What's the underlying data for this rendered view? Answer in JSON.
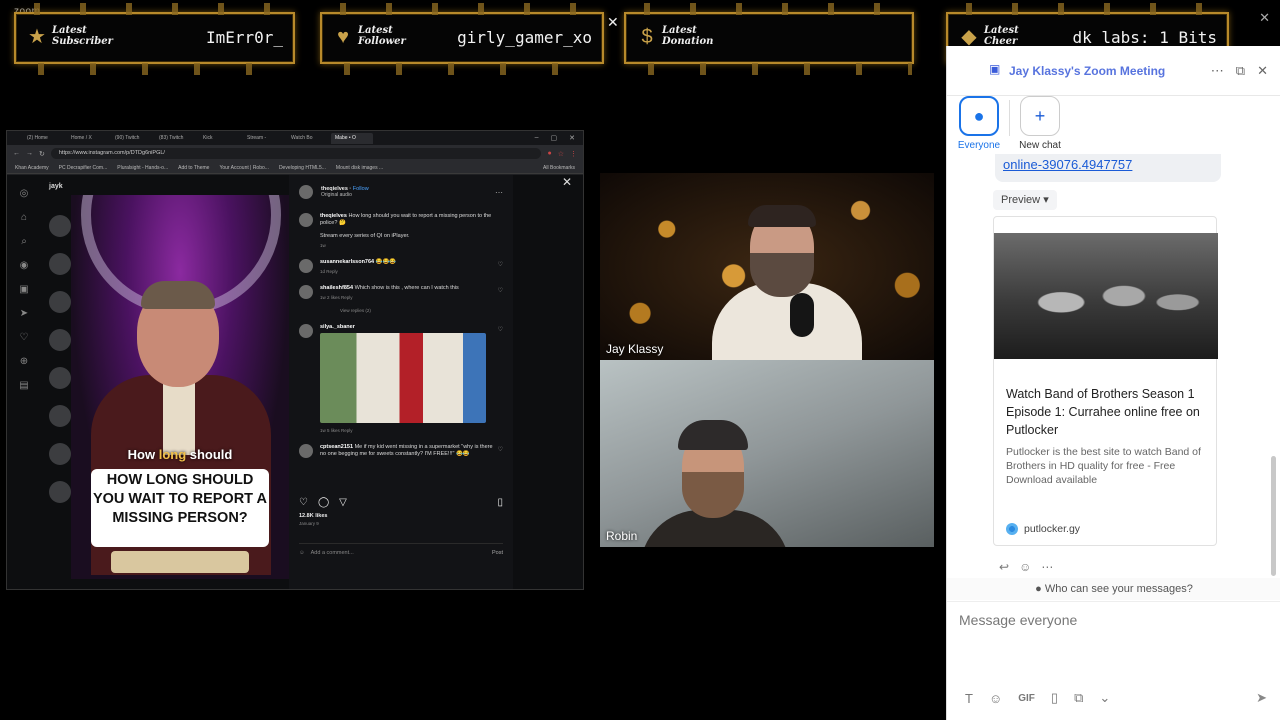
{
  "app": {
    "name": "zoom"
  },
  "alerts": [
    {
      "title": "Latest\nSubscriber",
      "value": "ImErr0r_"
    },
    {
      "title": "Latest\nFollower",
      "value": "girly_gamer_xo"
    },
    {
      "title": "Latest\nDonation",
      "value": ""
    },
    {
      "title": "Latest\nCheer",
      "value": "dk_labs: 1 Bits"
    }
  ],
  "browser": {
    "tabs": [
      "(2) Home",
      "Home / X",
      "(90) Twitch",
      "(83) Twitch",
      "Kick",
      "Stream - ",
      "Watch Bo",
      "Mabe • O"
    ],
    "url": "https://www.instagram.com/p/DTDg6niPGL/",
    "bookmarks": [
      "Khan Academy",
      "PC Decrapifier Com...",
      "Pluralsight - Hands-o...",
      "Add to Theme",
      "Your Account | Robo...",
      "Developing HTML5...",
      "Mount disk images ..."
    ],
    "bookmarks_right": "All Bookmarks",
    "ig_user": "jayk"
  },
  "reel": {
    "caption_pre": "How ",
    "caption_hl": "long",
    "caption_post": " should",
    "card_text": "HOW LONG SHOULD YOU WAIT TO REPORT A MISSING PERSON?"
  },
  "post": {
    "author": "theqielves",
    "follow": "Follow",
    "audio": "Original audio",
    "caption_user": "theqielves",
    "caption": "How long should you wait to report a missing person to the police? 🤔",
    "caption_line2": "Stream every series of QI on iPlayer.",
    "caption_meta": "1w",
    "comments": [
      {
        "user": "susannekarlsson764",
        "text": "😂😂😂",
        "meta": "1d   Reply"
      },
      {
        "user": "shaileshf854",
        "text": "Which show is this , where can I watch this",
        "meta": "1w   2 likes   Reply",
        "replies": "View replies (2)"
      },
      {
        "user": "silya._sbaner",
        "text": "",
        "meta": "1w   5 likes   Reply"
      },
      {
        "user": "cptsean2151",
        "text": "Me if my kid went missing in a supermarket \"why is there no one begging me for sweets constantly? I'M FREE!!!\" 😂😂",
        "meta": ""
      }
    ],
    "likes": "12.8K likes",
    "date": "January 9",
    "add_comment": "Add a comment...",
    "post_label": "Post"
  },
  "video": [
    {
      "name": "Jay Klassy"
    },
    {
      "name": "Robin"
    }
  ],
  "chat": {
    "title": "Jay Klassy's Zoom Meeting",
    "tabs": [
      {
        "label": "Everyone"
      },
      {
        "label": "New chat"
      }
    ],
    "link": "online-39076.4947757",
    "preview_label": "Preview",
    "card_title": "Watch Band of Brothers Season 1 Episode 1: Currahee online free on Putlocker",
    "card_desc": "Putlocker is the best site to watch Band of Brothers in HD quality for free - Free Download available",
    "card_source": "putlocker.gy",
    "who_can_see": "Who can see your messages?",
    "placeholder": "Message everyone",
    "gif_label": "GIF"
  }
}
